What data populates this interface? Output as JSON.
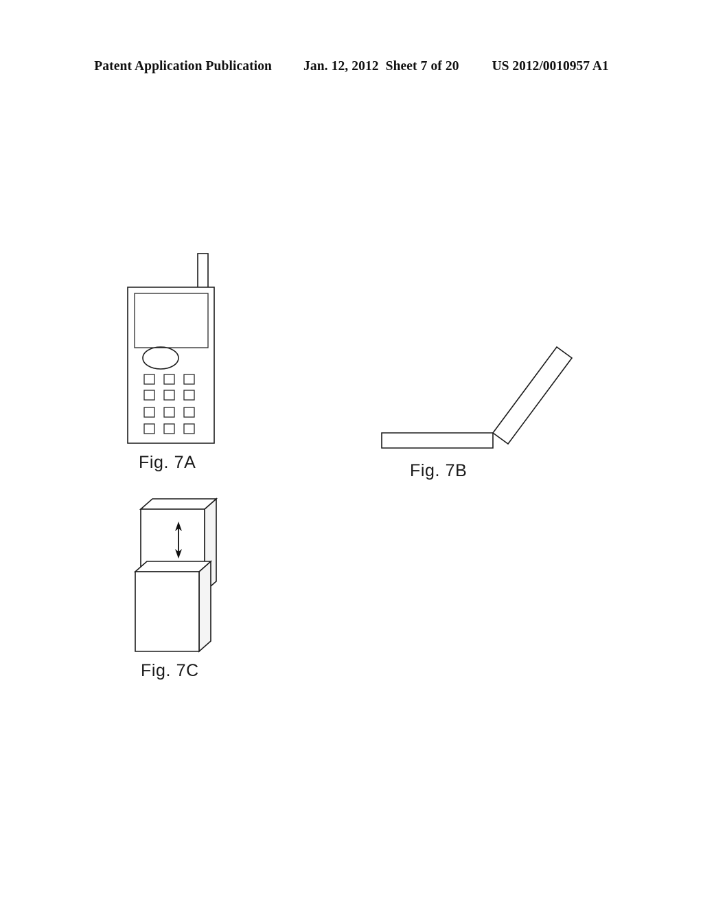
{
  "header": {
    "publication": "Patent Application Publication",
    "date": "Jan. 12, 2012",
    "sheet": "Sheet 7 of 20",
    "doc_number": "US 2012/0010957 A1"
  },
  "figures": [
    {
      "id": "7A",
      "caption": "Fig. 7A",
      "subject": "candy-bar mobile phone front view",
      "parts": {
        "antenna": "antenna stub",
        "body": "phone body outline",
        "display": "display screen rectangle",
        "speaker": "oval speaker / navigation button",
        "keypad": "4 row by 3 column keypad grid",
        "keypad_rows": 4,
        "keypad_cols": 3,
        "key_count": 12
      }
    },
    {
      "id": "7B",
      "caption": "Fig. 7B",
      "subject": "clamshell flip phone side view, open",
      "parts": {
        "base": "lower horizontal housing bar",
        "lid": "upper angled housing bar",
        "hinge": "hinge joint at right end of base",
        "lid_angle_deg": 55
      }
    },
    {
      "id": "7C",
      "caption": "Fig. 7C",
      "subject": "slider phone perspective view",
      "parts": {
        "upper_block": "upper sliding body block",
        "lower_block": "lower body block",
        "slide_arrow": "double headed vertical slide arrow"
      }
    }
  ],
  "colors": {
    "ink": "#1b1b1b",
    "paper": "#ffffff",
    "shade": "#f4f4f4"
  }
}
